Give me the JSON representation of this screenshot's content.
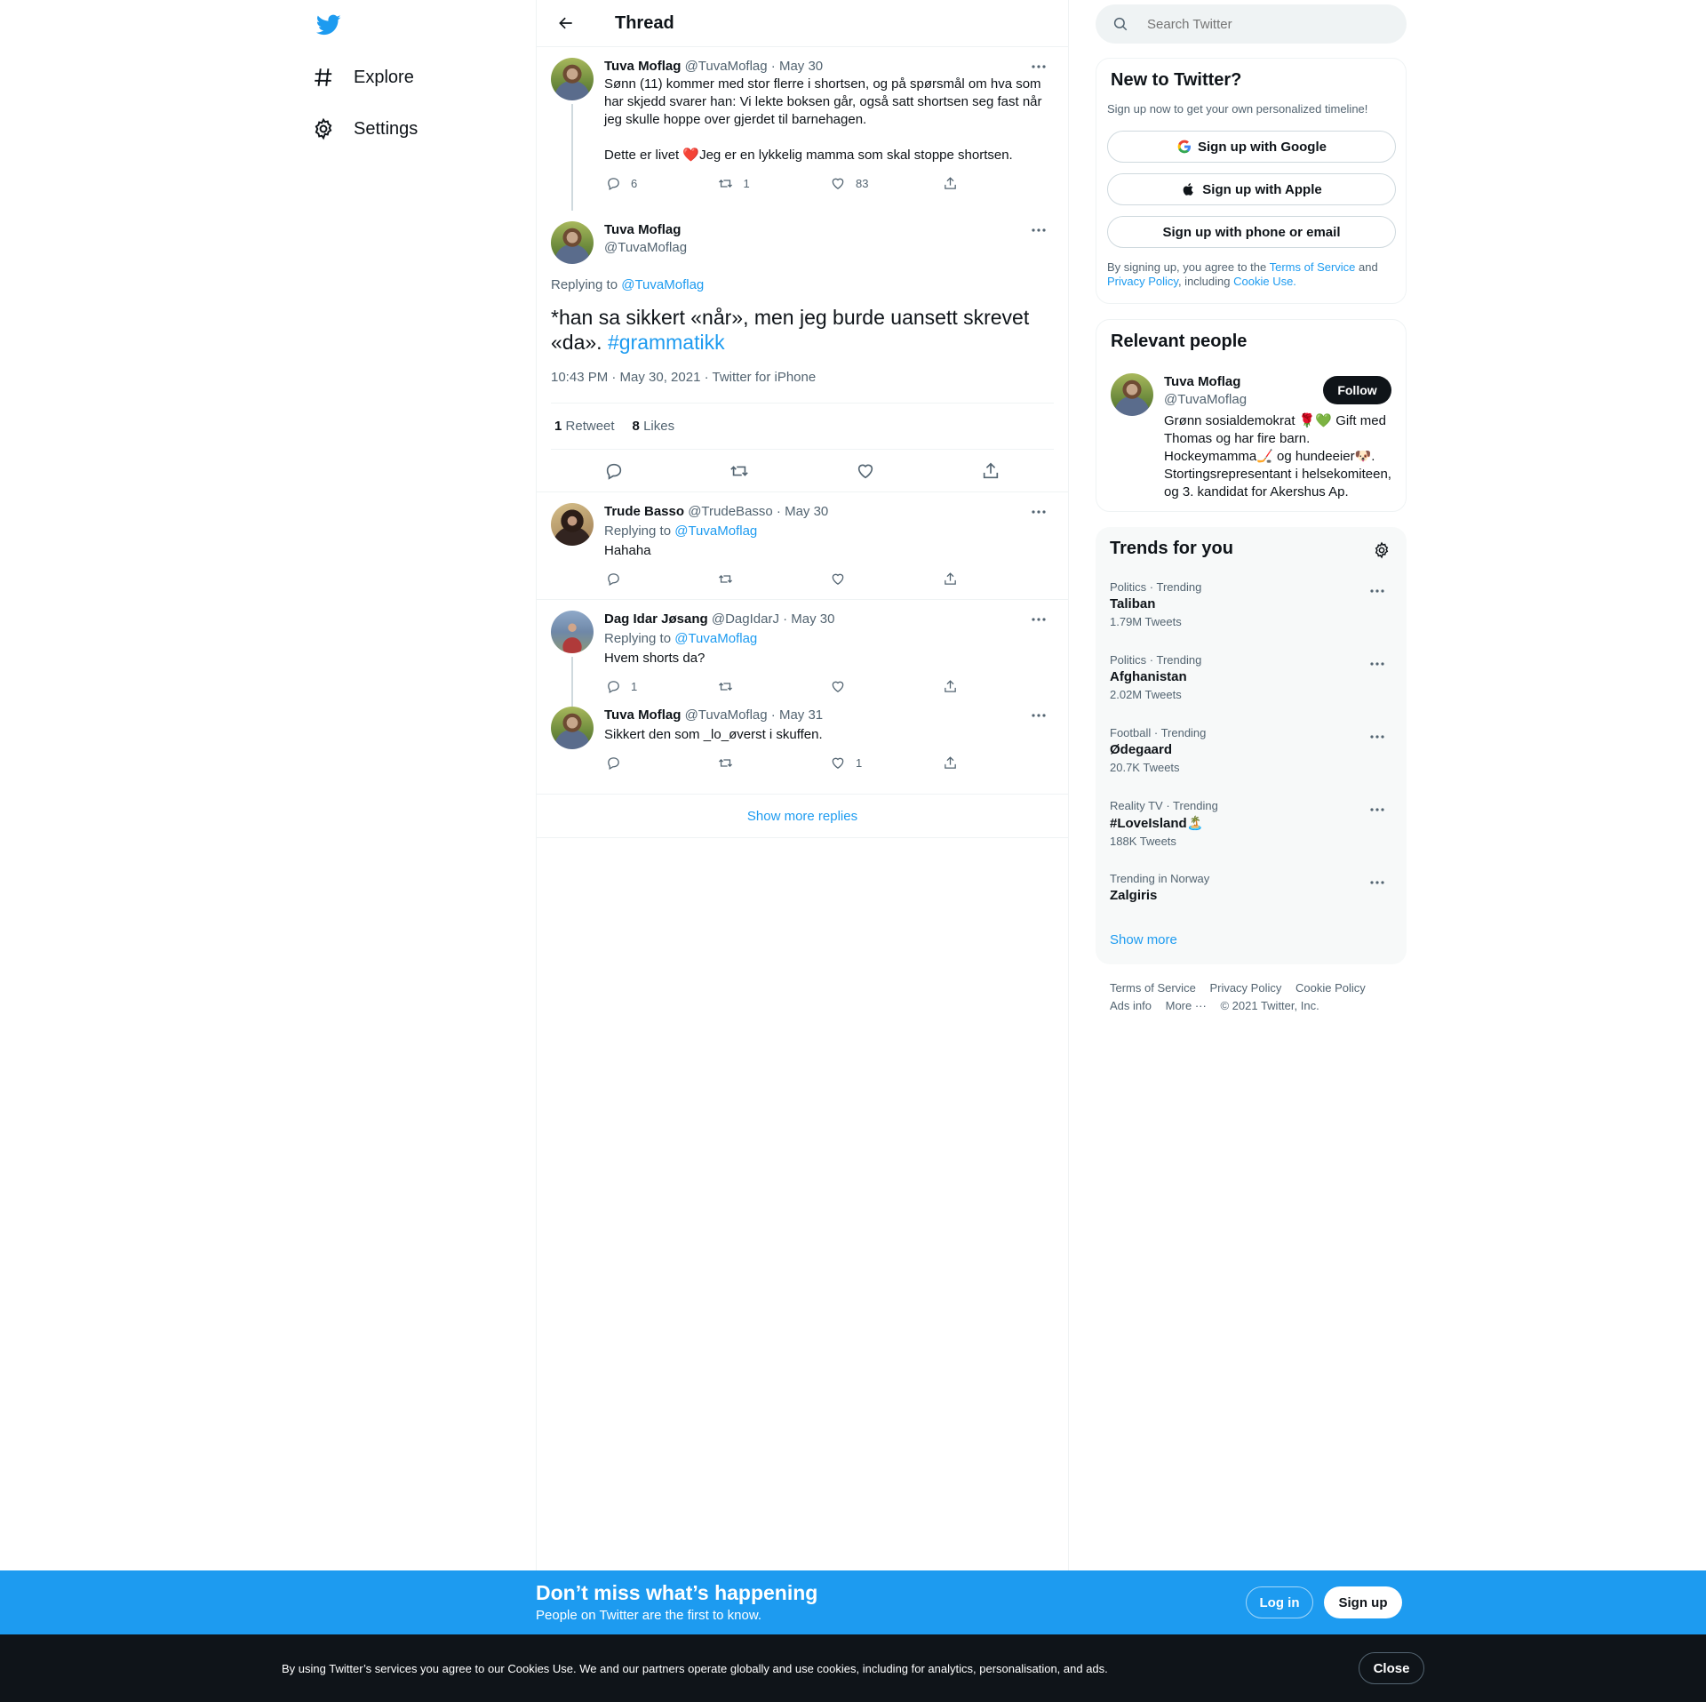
{
  "nav": {
    "explore": "Explore",
    "settings": "Settings"
  },
  "header": {
    "title": "Thread"
  },
  "tweet1": {
    "name": "Tuva Moflag",
    "handle": "@TuvaMoflag",
    "date": "· May 30",
    "text1": "Sønn (11) kommer med stor flerre i shortsen, og på spørsmål om hva som har skjedd svarer han: Vi lekte boksen går, også satt shortsen seg fast når jeg skulle hoppe over gjerdet til barnehagen.",
    "text2_a": "Dette er livet ",
    "text2_emoji": "❤️",
    "text2_b": "Jeg er en lykkelig mamma som skal stoppe shortsen.",
    "replies": "6",
    "retweets": "1",
    "likes": "83"
  },
  "main": {
    "name": "Tuva Moflag",
    "handle": "@TuvaMoflag",
    "replying_label": "Replying to",
    "replying_to": "@TuvaMoflag",
    "text": "*han sa sikkert «når», men jeg burde uansett skrevet «da». ",
    "hashtag": "#grammatikk",
    "time": "10:43 PM · May 30, 2021 · Twitter for iPhone",
    "rt_count": "1",
    "rt_label": "Retweet",
    "like_count": "8",
    "like_label": "Likes"
  },
  "reply1": {
    "name": "Trude Basso",
    "handle": "@TrudeBasso",
    "date": "· May 30",
    "replying_label": "Replying to",
    "replying_to": "@TuvaMoflag",
    "text": "Hahaha"
  },
  "reply2": {
    "name": "Dag Idar Jøsang",
    "handle": "@DagIdarJ",
    "date": "· May 30",
    "replying_label": "Replying to",
    "replying_to": "@TuvaMoflag",
    "text": "Hvem shorts da?",
    "replies": "1"
  },
  "reply3": {
    "name": "Tuva Moflag",
    "handle": "@TuvaMoflag",
    "date": "· May 31",
    "text": "Sikkert den som _lo_øverst i skuffen.",
    "likes": "1"
  },
  "show_more_replies": "Show more replies",
  "search": {
    "placeholder": "Search Twitter"
  },
  "new_to_twitter": {
    "title": "New to Twitter?",
    "subtitle": "Sign up now to get your own personalized timeline!",
    "google": "Sign up with Google",
    "apple": "Sign up with Apple",
    "phone": "Sign up with phone or email",
    "legal_a": "By signing up, you agree to the ",
    "tos": "Terms of Service",
    "legal_b": " and",
    "privacy": "Privacy Policy",
    "legal_c": ", including ",
    "cookie": "Cookie Use."
  },
  "relevant": {
    "title": "Relevant people",
    "name": "Tuva Moflag",
    "handle": "@TuvaMoflag",
    "follow": "Follow",
    "bio": "Grønn sosialdemokrat 🌹💚 Gift med Thomas og har fire barn. Hockeymamma🏒 og hundeeier🐶. Stortingsrepresentant i helsekomiteen, og 3. kandidat for Akershus Ap."
  },
  "trends": {
    "title": "Trends for you",
    "items": [
      {
        "category": "Politics · Trending",
        "name": "Taliban",
        "count": "1.79M Tweets"
      },
      {
        "category": "Politics · Trending",
        "name": "Afghanistan",
        "count": "2.02M Tweets"
      },
      {
        "category": "Football · Trending",
        "name": "Ødegaard",
        "count": "20.7K Tweets"
      },
      {
        "category": "Reality TV · Trending",
        "name": "#LoveIsland🏝️",
        "count": "188K Tweets"
      },
      {
        "category": "Trending in Norway",
        "name": "Zalgiris",
        "count": ""
      }
    ],
    "show_more": "Show more"
  },
  "footer": {
    "tos": "Terms of Service",
    "privacy": "Privacy Policy",
    "cookie": "Cookie Policy",
    "ads": "Ads info",
    "more": "More ···",
    "copyright": "© 2021 Twitter, Inc."
  },
  "banner": {
    "title": "Don’t miss what’s happening",
    "subtitle": "People on Twitter are the first to know.",
    "login": "Log in",
    "signup": "Sign up"
  },
  "cookie_bar": {
    "text": "By using Twitter’s services you agree to our Cookies Use. We and our partners operate globally and use cookies, including for analytics, personalisation, and ads.",
    "close": "Close"
  },
  "colors": {
    "accent": "#1d9bf0",
    "text": "#0f1419",
    "secondary": "#536471",
    "like_red": "#f91880"
  }
}
